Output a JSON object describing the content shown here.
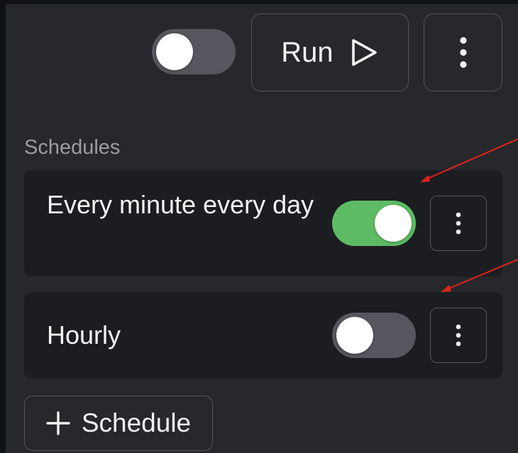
{
  "header": {
    "enabled": false,
    "run_label": "Run",
    "run_icon": "play-outline-icon",
    "more_icon": "vertical-dots-icon"
  },
  "schedules": {
    "title": "Schedules",
    "items": [
      {
        "label": "Every minute every day",
        "enabled": true
      },
      {
        "label": "Hourly",
        "enabled": false
      }
    ],
    "add_label": "Schedule",
    "add_icon": "plus-icon"
  },
  "colors": {
    "toggle_on": "#5dbb63",
    "toggle_off": "#55565e",
    "annotation_arrow": "#e0241b"
  }
}
